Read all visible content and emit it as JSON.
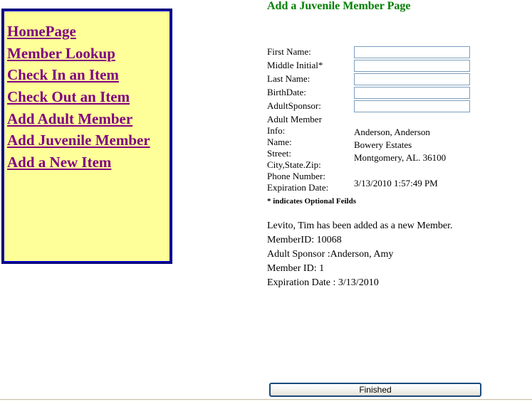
{
  "page": {
    "title": "Add a Juvenile Member Page",
    "title_color": "#008000",
    "background": "#ffffff"
  },
  "sidebar": {
    "background": "#ffff99",
    "border_color": "#000080",
    "link_color": "#800080",
    "items": [
      {
        "label": "HomePage",
        "name": "nav-homepage"
      },
      {
        "label": "Member Lookup",
        "name": "nav-member-lookup"
      },
      {
        "label": "Check In an Item",
        "name": "nav-check-in-item"
      },
      {
        "label": "Check Out an Item",
        "name": "nav-check-out-item"
      },
      {
        "label": "Add Adult Member",
        "name": "nav-add-adult-member"
      },
      {
        "label": "Add Juvenile Member",
        "name": "nav-add-juvenile-member"
      },
      {
        "label": "Add a New Item",
        "name": "nav-add-new-item"
      }
    ]
  },
  "form": {
    "fields": [
      {
        "label": "First Name:",
        "value": "",
        "placeholder": ""
      },
      {
        "label": "Middle Initial*",
        "value": "",
        "placeholder": ""
      },
      {
        "label": "Last Name:",
        "value": "",
        "placeholder": ""
      },
      {
        "label": "BirthDate:",
        "value": "",
        "placeholder": ""
      },
      {
        "label": "AdultSponsor:",
        "value": "",
        "placeholder": ""
      }
    ],
    "input_border_color": "#7b9ebd",
    "optional_note": "* indicates Optional Feilds"
  },
  "adult_info": {
    "heading": "Adult Member Info:",
    "heading_line1": "Adult Member",
    "heading_line2": "Info:",
    "labels": [
      "Name:",
      "Street:",
      "City,State.Zip:",
      "Phone Number:",
      "Expiration Date:"
    ],
    "values": [
      "Anderson, Anderson",
      "Bowery Estates",
      "Montgomery, AL. 36100",
      "",
      "3/13/2010 1:57:49 PM"
    ]
  },
  "result": {
    "lines": [
      "Levito, Tim has been added as a new Member.",
      "MemberID: 10068",
      "Adult Sponsor :Anderson, Amy",
      "Member ID: 1",
      "Expiration Date : 3/13/2010"
    ]
  },
  "footer": {
    "finished_label": "Finished"
  }
}
